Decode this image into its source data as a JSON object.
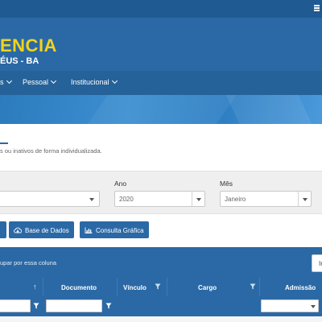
{
  "brand": {
    "title": "ENCIA",
    "subtitle": "ÉUS - BA"
  },
  "nav": {
    "items": [
      {
        "label": "s"
      },
      {
        "label": "Pessoal"
      },
      {
        "label": "Institucional"
      }
    ]
  },
  "intro": {
    "description": "s ou inativos de forma individualizada."
  },
  "filters": {
    "ano_label": "Ano",
    "ano_value": "2020",
    "mes_label": "Mês",
    "mes_value": "Janeiro"
  },
  "actions": {
    "base_dados": "Base de Dados",
    "consulta_grafica": "Consulta Gráfica"
  },
  "grid": {
    "group_hint": "upar por essa coluna",
    "toolbar_button": "In",
    "columns": {
      "documento": "Documento",
      "vinculo": "Vínculo",
      "cargo": "Cargo",
      "admissao": "Admissão"
    }
  },
  "colors": {
    "topbar": "#1f5a93",
    "brand_bg": "#2a69a5",
    "brand_title": "#f2d31b",
    "nav_bg": "#256299",
    "button_bg": "#2a69a5"
  },
  "icons": {
    "menu": "hamburger-icon",
    "sort": "sort-up-icon",
    "filter": "funnel-icon",
    "cloud": "cloud-download-icon",
    "chart": "bar-chart-icon"
  }
}
